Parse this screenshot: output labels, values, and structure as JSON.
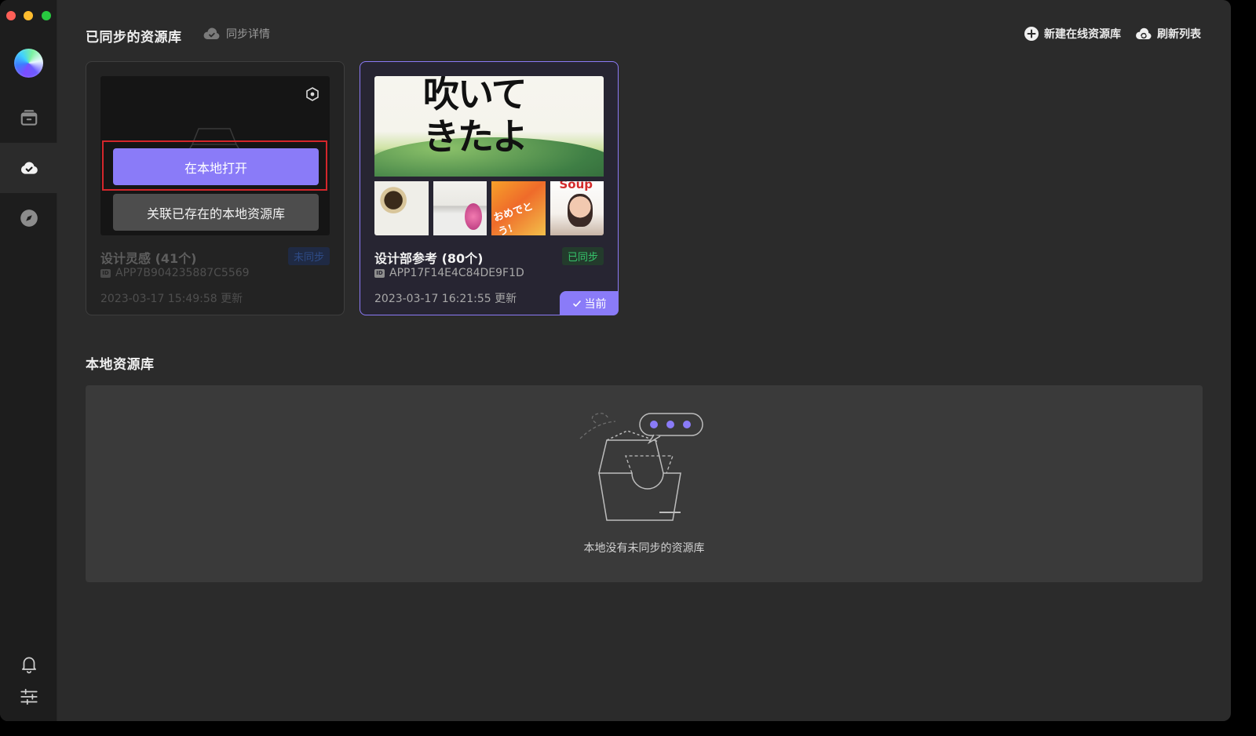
{
  "colors": {
    "accent": "#8a7bf8",
    "synced": "#36c46b",
    "unsynced": "#2e4b86",
    "highlight": "#d3262b"
  },
  "sidebar": {
    "items": [
      {
        "name": "library",
        "icon": "box-icon"
      },
      {
        "name": "cloud-sync",
        "icon": "cloud-check-icon",
        "active": true
      },
      {
        "name": "explore",
        "icon": "compass-icon"
      }
    ],
    "bottom": [
      {
        "name": "notifications",
        "icon": "bell-icon"
      },
      {
        "name": "settings",
        "icon": "sliders-icon"
      }
    ]
  },
  "header": {
    "title": "已同步的资源库",
    "sync_detail": "同步详情",
    "new_online_library": "新建在线资源库",
    "refresh_list": "刷新列表"
  },
  "cards": [
    {
      "title": "设计灵感 (41个)",
      "status": "未同步",
      "id": "APP7B904235887C5569",
      "updated": "2023-03-17 15:49:58 更新",
      "open_local": "在本地打开",
      "link_existing": "关联已存在的本地资源库"
    },
    {
      "title": "设计部参考 (80个)",
      "status": "已同步",
      "id": "APP17F14E4C84DE9F1D",
      "updated": "2023-03-17 16:21:55 更新",
      "current": "当前",
      "hero_text": "吹いて\nきたよ",
      "tile3_text": "おめでとう!",
      "tile4_text": "Soup"
    }
  ],
  "local": {
    "title": "本地资源库",
    "empty_text": "本地没有未同步的资源库"
  }
}
